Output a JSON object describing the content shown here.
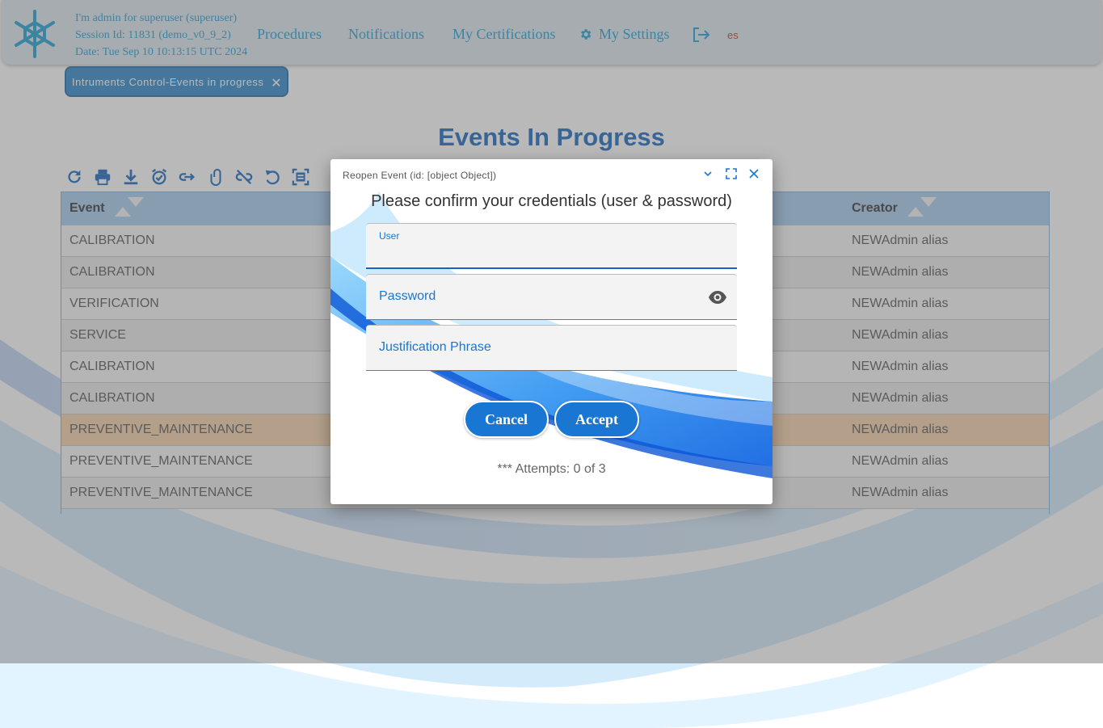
{
  "header": {
    "user_line": "I'm admin for superuser (superuser)",
    "session_line": "Session Id: 11831 (demo_v0_9_2)",
    "date_line": "Date: Tue Sep 10 10:13:15 UTC 2024",
    "nav": {
      "procedures": "Procedures",
      "notifications": "Notifications",
      "certifications": "My Certifications",
      "settings": "My Settings"
    },
    "language": "es"
  },
  "tab": {
    "label": "Intruments Control-Events in progress",
    "close": "✕"
  },
  "page": {
    "title": "Events In Progress"
  },
  "toolbar": {
    "icons": [
      "refresh-icon",
      "print-icon",
      "download-icon",
      "alarm-icon",
      "link-forward-icon",
      "attachment-icon",
      "unlink-icon",
      "undo-icon",
      "expand-icon"
    ]
  },
  "table": {
    "columns": [
      "Event",
      "Creator"
    ],
    "rows": [
      {
        "event": "CALIBRATION",
        "creator": "NEWAdmin alias"
      },
      {
        "event": "CALIBRATION",
        "creator": "NEWAdmin alias"
      },
      {
        "event": "VERIFICATION",
        "creator": "NEWAdmin alias"
      },
      {
        "event": "SERVICE",
        "creator": "NEWAdmin alias"
      },
      {
        "event": "CALIBRATION",
        "creator": "NEWAdmin alias"
      },
      {
        "event": "CALIBRATION",
        "creator": "NEWAdmin alias"
      },
      {
        "event": "PREVENTIVE_MAINTENANCE",
        "creator": "NEWAdmin alias",
        "highlighted": true
      },
      {
        "event": "PREVENTIVE_MAINTENANCE",
        "creator": "NEWAdmin alias"
      },
      {
        "event": "PREVENTIVE_MAINTENANCE",
        "creator": "NEWAdmin alias"
      }
    ]
  },
  "dialog": {
    "title": "Reopen Event (id: [object Object])",
    "heading": "Please confirm your credentials (user & password)",
    "user_label": "User",
    "password_label": "Password",
    "justification_label": "Justification Phrase",
    "cancel": "Cancel",
    "accept": "Accept",
    "attempts": "*** Attempts: 0 of 3"
  },
  "colors": {
    "accent": "#1976d2",
    "title": "#1565c0",
    "header_text": "#1a9fd6",
    "highlight_row": "#f6d2a9",
    "table_header": "#a7ccee"
  }
}
